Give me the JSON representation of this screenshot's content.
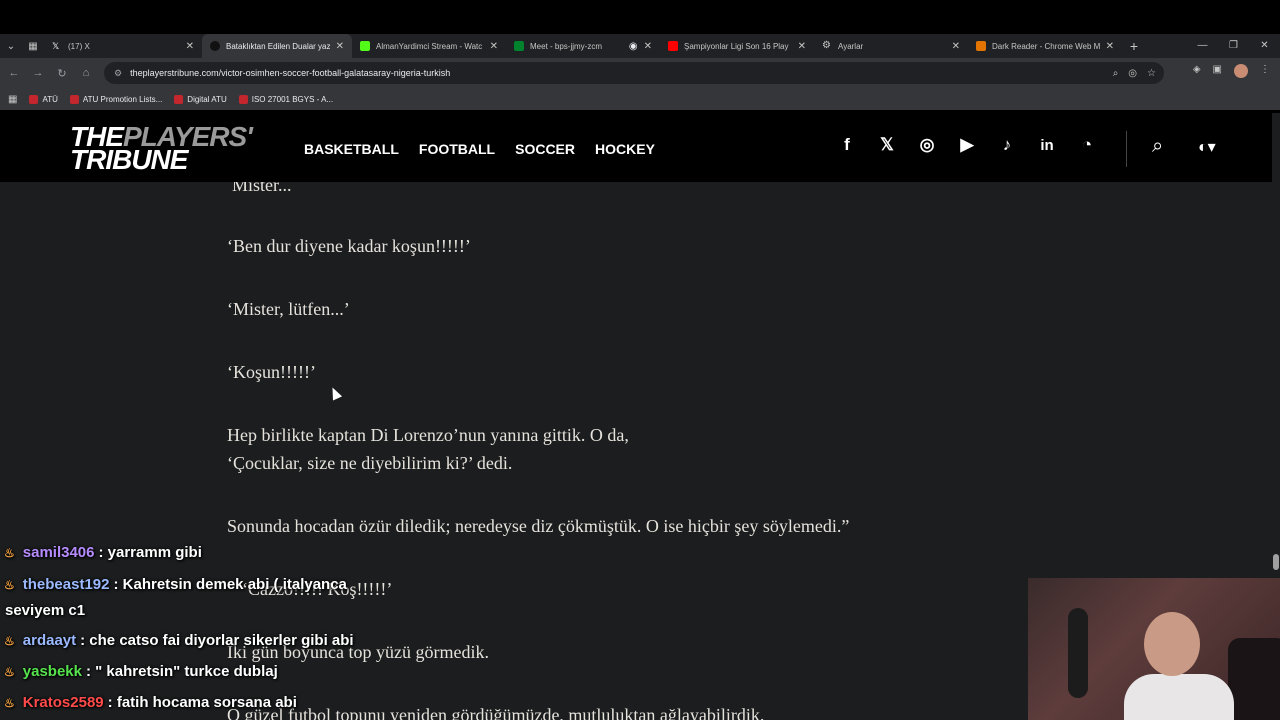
{
  "browser": {
    "tabs": [
      {
        "title": "(17) X",
        "favicon_color": "#ffffff",
        "active": false
      },
      {
        "title": "Bataklıktan Edilen Dualar yaza",
        "favicon_color": "#202124",
        "active": true
      },
      {
        "title": "AlmanYardimci Stream - Watc",
        "favicon_color": "#53fc18",
        "active": false
      },
      {
        "title": "Meet - bps-jjmy-zcm",
        "favicon_color": "#00832d",
        "active": false
      },
      {
        "title": "Şampiyonlar Ligi Son 16 Play",
        "favicon_color": "#ff0000",
        "active": false
      },
      {
        "title": "Ayarlar",
        "favicon_color": "#c4c7c5",
        "active": false
      },
      {
        "title": "Dark Reader - Chrome Web M",
        "favicon_color": "#e37400",
        "active": false
      }
    ],
    "url": "theplayerstribune.com/victor-osimhen-soccer-football-galatasaray-nigeria-turkish",
    "bookmarks": [
      {
        "label": "ATÜ"
      },
      {
        "label": "ATU Promotion Lists..."
      },
      {
        "label": "Digital ATU"
      },
      {
        "label": "ISO 27001 BGYS - A..."
      }
    ]
  },
  "site": {
    "logo_line1_white": "THE",
    "logo_line1_grey": "PLAYERS'",
    "logo_line2": "TRIBUNE",
    "nav": [
      "BASKETBALL",
      "FOOTBALL",
      "SOCCER",
      "HOCKEY"
    ]
  },
  "article": {
    "lines": [
      "Mister...",
      "‘Ben dur diyene kadar koşun!!!!!’",
      "‘Mister, lütfen...’",
      "‘Koşun!!!!!’",
      "Hep birlikte kaptan Di Lorenzo’nun yanına gittik. O da,",
      "‘Çocuklar, size ne diyebilirim ki?’ dedi.",
      "Sonunda hocadan özür diledik; neredeyse diz çökmüştük. O ise hiçbir şey söylemedi.”",
      "‘Cazzo!!!!! Koş!!!!!’",
      "İki gün boyunca top yüzü görmedik.",
      "O güzel futbol topunu yeniden gördüğümüzde, mutluluktan ağlayabilirdik."
    ]
  },
  "chat": {
    "messages": [
      {
        "user": "samil3406",
        "text": ": yarramm gibi",
        "color": "#b68cff"
      },
      {
        "user": "thebeast192",
        "text": ": Kahretsin demek abi ( italyanca",
        "color": "#9ab9ff"
      },
      {
        "user": "",
        "text": "seviyem c1",
        "color": "#ffffff"
      },
      {
        "user": "ardaayt",
        "text": ": che catso fai diyorlar sikerler gibi abi",
        "color": "#9ab9ff"
      },
      {
        "user": "yasbekk",
        "text": ": \" kahretsin\" turkce dublaj",
        "color": "#57e34d"
      },
      {
        "user": "Kratos2589",
        "text": ": fatih hocama sorsana abi",
        "color": "#ff4b4b"
      }
    ]
  }
}
